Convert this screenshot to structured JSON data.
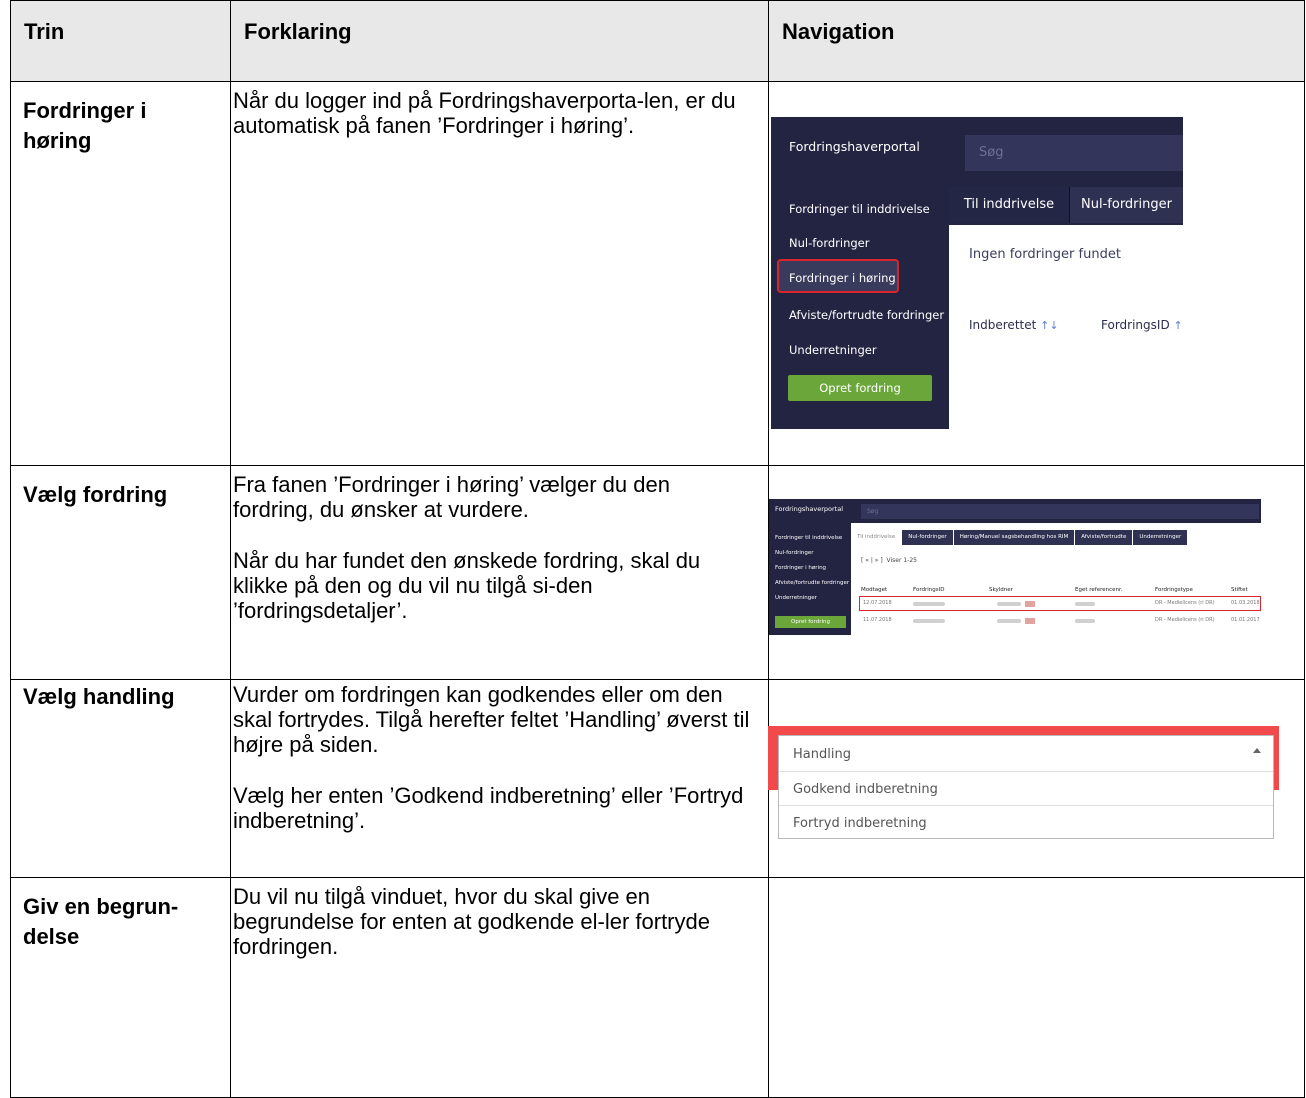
{
  "headers": {
    "trin": "Trin",
    "forklaring": "Forklaring",
    "navigation": "Navigation"
  },
  "rows": [
    {
      "step": "Fordringer i høring",
      "text1": "Når du logger ind på Fordringshaverporta-len, er du automatisk på fanen ’Fordringer i høring’."
    },
    {
      "step": "Vælg fordring",
      "text1": "Fra fanen ’Fordringer i høring’ vælger du den fordring, du ønsker at vurdere.",
      "text2": "Når du har fundet den ønskede fordring, skal du klikke på den og du vil nu tilgå si-den ’fordringsdetaljer’."
    },
    {
      "step": "Vælg handling",
      "text1": "Vurder om fordringen kan godkendes eller om den skal fortrydes. Tilgå herefter feltet ’Handling’ øverst til højre på siden.",
      "text2": "Vælg her enten ’Godkend indberetning’ eller ’Fortryd indberetning’."
    },
    {
      "step": "Giv en begrun-delse",
      "text1": "Du vil nu tilgå vinduet, hvor du skal give en begrundelse for enten at godkende el-ler fortryde fordringen."
    }
  ],
  "shot1": {
    "brand": "Fordringshaverportal",
    "search_placeholder": "Søg",
    "sidebar": [
      "Fordringer til inddrivelse",
      "Nul-fordringer",
      "Fordringer i høring",
      "Afviste/fortrudte fordringer",
      "Underretninger"
    ],
    "button": "Opret fordring",
    "tabs": [
      "Til inddrivelse",
      "Nul-fordringer"
    ],
    "empty": "Ingen fordringer fundet",
    "columns": [
      "Indberettet",
      "FordringsID"
    ]
  },
  "shot2": {
    "brand": "Fordringshaverportal",
    "search_placeholder": "Søg",
    "sidebar": [
      "Fordringer til inddrivelse",
      "Nul-fordringer",
      "Fordringer i høring",
      "Afviste/fortrudte fordringer",
      "Underretninger"
    ],
    "button": "Opret fordring",
    "tabs": [
      "Til inddrivelse",
      "Nul-fordringer",
      "Høring/Manuel sagsbehandling hos RIM",
      "Afviste/fortrudte",
      "Underretninger"
    ],
    "pager": "Viser 1-25",
    "columns": [
      "Modtaget",
      "FordringsID",
      "Skyldner",
      "Eget referencenr.",
      "Fordringstype",
      "Stiftet"
    ],
    "rows": [
      {
        "date": "12.07.2018",
        "type": "DR - Medielicens (ri DR)",
        "stiftet": "01.03.2018"
      },
      {
        "date": "11.07.2018",
        "type": "DR - Medielicens (ri DR)",
        "stiftet": "01.01.2017"
      }
    ]
  },
  "shot3": {
    "header": "Handling",
    "options": [
      "Godkend indberetning",
      "Fortryd indberetning"
    ]
  },
  "colors": {
    "sidebar": "#232442",
    "accent_green": "#6aa63a",
    "highlight_red": "#d9262e",
    "dropdown_red": "#f2494a"
  }
}
